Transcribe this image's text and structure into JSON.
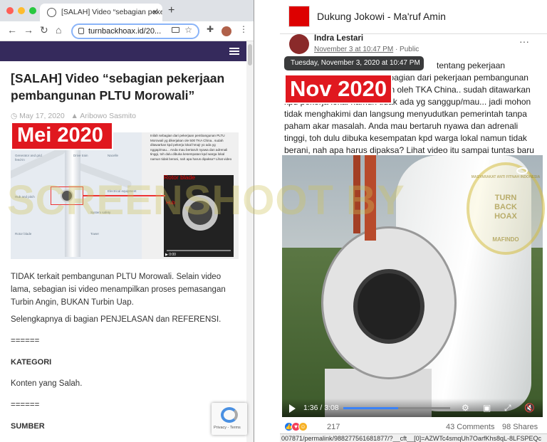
{
  "left_browser": {
    "tab_title": "[SALAH] Video “sebagian pekerj",
    "tab_close": "×",
    "new_tab": "+",
    "url": "turnbackhoax.id/20...",
    "nav_back": "←",
    "nav_forward": "→",
    "nav_reload": "↻",
    "nav_home": "⌂",
    "article": {
      "title": "[SALAH] Video “sebagian pekerjaan pembangunan PLTU Morowali”",
      "date": "May 17, 2020",
      "author": "Aribowo Sasmito",
      "image_label": "Mei 2020",
      "image_caption_rotor": "Rotor blade",
      "image_caption_hub": "Hub",
      "image_video_time": "0:00",
      "image_side_text": "Inilah sebagian dari pekerjaan pembangunan PLTU Morowali yg dikerjakan ole 500 TKA China.. sudah ditawarkan kpd pekerja lokal hmaj! yo ada yg nggap/mau... Anda mau bertaruh nyawa dan adrenali tinggi, toh dulu dibuka kesempatan kpd warga lokal namun tidak berani, nah apa harus dipaksa? Lihat video",
      "image_infographic_labels": [
        "Generator and grid feed-in",
        "Drive train",
        "Nacelle",
        "Hub and pitch",
        "Electrical equipment",
        "System safety",
        "Rotor blade",
        "Tower"
      ],
      "paragraph1": "TIDAK terkait pembangunan PLTU Morowali. Selain video lama, sebagian isi video menampilkan proses pemasangan Turbin Angin, BUKAN Turbin Uap.",
      "paragraph2": "Selengkapnya di bagian PENJELASAN dan REFERENSI.",
      "separator1": "======",
      "section_kategori": "KATEGORI",
      "kategori_value": "Konten yang Salah.",
      "separator2": "======",
      "section_sumber": "SUMBER"
    },
    "captcha_text": "Privacy - Terms"
  },
  "right_facebook": {
    "page_name": "Dukung Jokowi - Ma'ruf Amin",
    "user_name": "Indra Lestari",
    "post_date": "November 3 at 10:47 PM",
    "privacy": "· Public",
    "menu_dots": "···",
    "tooltip": "Tuesday, November 3, 2020 at 10:47 PM",
    "date_label": "Nov 2020",
    "post_text": "tentang pekerjaan pertaruhan nyawa. Inilah sebagian dari pekerjaan pembangunan PLTU Morowali yg dikerjakan oleh TKA China.. sudah ditawarkan kpd pekerja lokal namun tidak ada yg sanggup/mau... jadi mohon tidak menghakimi dan langsung menyudutkan pemerintah tanpa paham akar masalah. Anda mau bertaruh nyawa dan adrenali tinggi, toh dulu dibuka kesempatan kpd warga lokal namun tidak berani, nah apa harus dipaksa? Lihat video itu sampai tuntas baru paham. Terimakasih.",
    "video_time": "1:36 / 3:08",
    "video_progress": 0.51,
    "reaction_count": "217",
    "comments": "43 Comments",
    "shares": "98 Shares"
  },
  "status_url": "007871/permalink/988277561681877/?__cft__[0]=AZWTc4smqUh7OarfKhs8qL-8LFSPEQc",
  "watermark": "SCREENSHOOT BY",
  "seal": {
    "top": "MASYARAKAT ANTI FITNAH INDONESIA",
    "line1": "TURN",
    "line2": "BACK",
    "line3": "HOAX",
    "bottom": "MAFINDO"
  },
  "colors": {
    "nav_band": "#352a5c",
    "label_red": "#e0181f",
    "fb_blue": "#385898"
  }
}
